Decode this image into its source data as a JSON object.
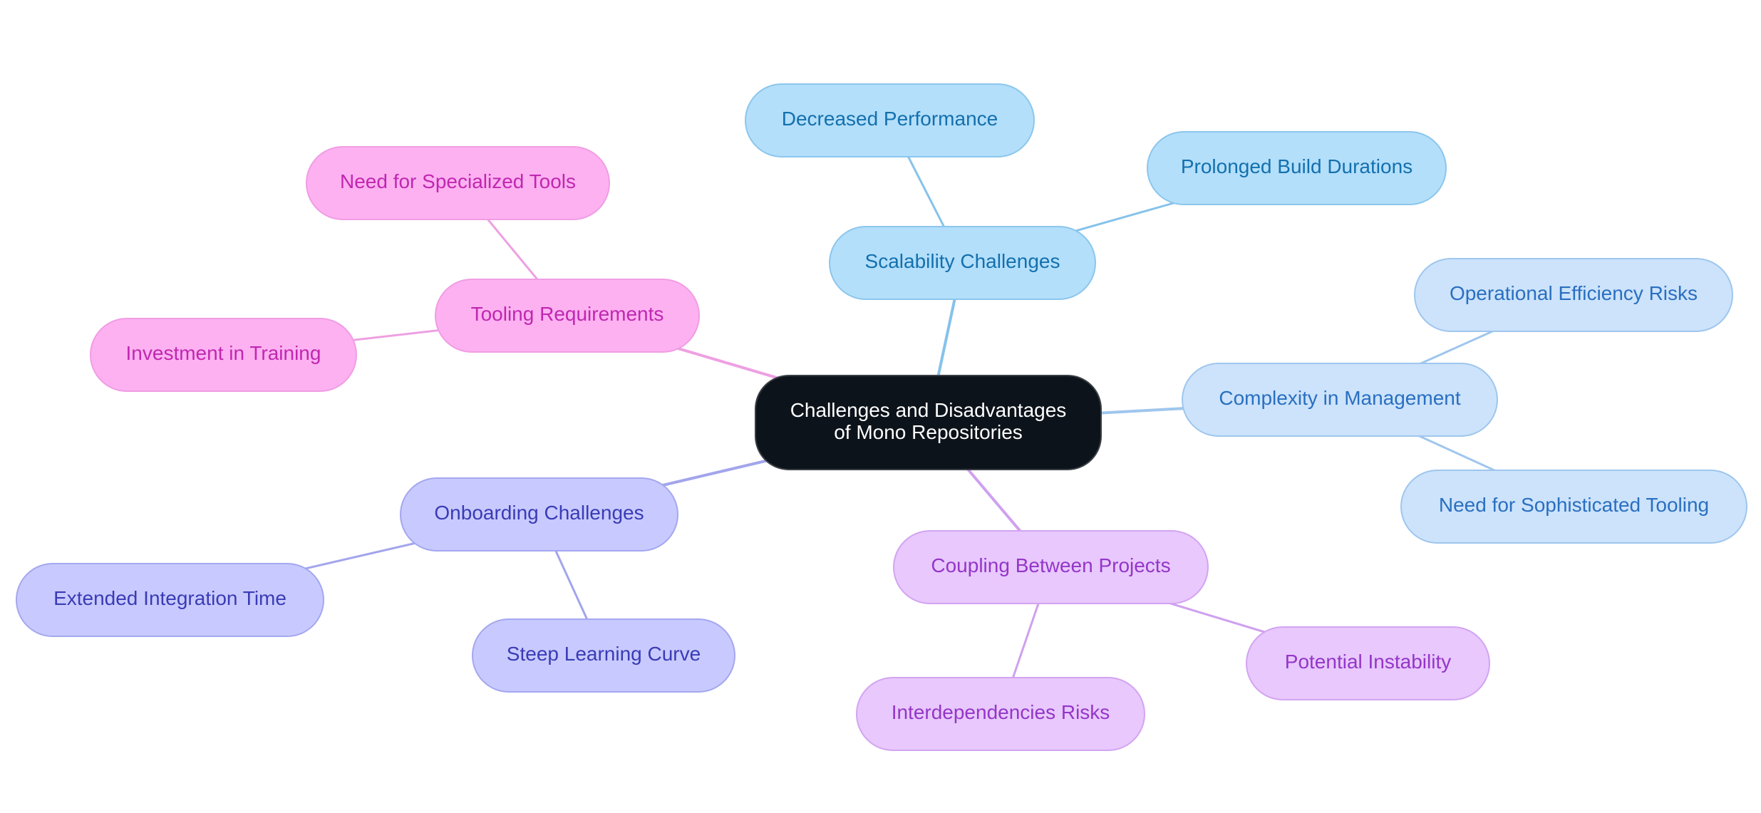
{
  "title": "Challenges and Disadvantages of Mono Repositories",
  "palette": {
    "root": {
      "fill": "#0d131a",
      "stroke": "#3a3f45",
      "text": "#ffffff",
      "edge": "#0d131a"
    },
    "sky": {
      "fill": "#b3dffb",
      "stroke": "#8cc6ec",
      "text": "#1470ad",
      "edge": "#86c2ea"
    },
    "blue": {
      "fill": "#cce3fb",
      "stroke": "#9fc6ee",
      "text": "#2a6fc0",
      "edge": "#9fc6ee"
    },
    "pink": {
      "fill": "#fdb1f1",
      "stroke": "#f09de4",
      "text": "#c027b0",
      "edge": "#eea0e2"
    },
    "indigo": {
      "fill": "#c8caff",
      "stroke": "#a4a7ef",
      "text": "#3a3bb5",
      "edge": "#a2a5ec"
    },
    "purple": {
      "fill": "#e8c8fd",
      "stroke": "#d3a4f1",
      "text": "#9436c8",
      "edge": "#cfa0ef"
    }
  },
  "nodes": [
    {
      "id": "root",
      "label_lines": [
        "Challenges and Disadvantages",
        "of Mono Repositories"
      ],
      "label": "Challenges and Disadvantages of Mono Repositories",
      "theme": "root",
      "parent": null
    },
    {
      "id": "scalability",
      "label": "Scalability Challenges",
      "theme": "sky",
      "parent": "root"
    },
    {
      "id": "decreased-performance",
      "label": "Decreased Performance",
      "theme": "sky",
      "parent": "scalability"
    },
    {
      "id": "prolonged-build",
      "label": "Prolonged Build Durations",
      "theme": "sky",
      "parent": "scalability"
    },
    {
      "id": "complexity",
      "label": "Complexity in Management",
      "theme": "blue",
      "parent": "root"
    },
    {
      "id": "operational-efficiency",
      "label": "Operational Efficiency Risks",
      "theme": "blue",
      "parent": "complexity"
    },
    {
      "id": "sophisticated-tooling",
      "label": "Need for Sophisticated Tooling",
      "theme": "blue",
      "parent": "complexity"
    },
    {
      "id": "coupling",
      "label": "Coupling Between Projects",
      "theme": "purple",
      "parent": "root"
    },
    {
      "id": "potential-instability",
      "label": "Potential Instability",
      "theme": "purple",
      "parent": "coupling"
    },
    {
      "id": "interdependencies",
      "label": "Interdependencies Risks",
      "theme": "purple",
      "parent": "coupling"
    },
    {
      "id": "onboarding",
      "label": "Onboarding Challenges",
      "theme": "indigo",
      "parent": "root"
    },
    {
      "id": "extended-integration",
      "label": "Extended Integration Time",
      "theme": "indigo",
      "parent": "onboarding"
    },
    {
      "id": "steep-learning",
      "label": "Steep Learning Curve",
      "theme": "indigo",
      "parent": "onboarding"
    },
    {
      "id": "tooling",
      "label": "Tooling Requirements",
      "theme": "pink",
      "parent": "root"
    },
    {
      "id": "specialized-tools",
      "label": "Need for Specialized Tools",
      "theme": "pink",
      "parent": "tooling"
    },
    {
      "id": "investment-training",
      "label": "Investment in Training",
      "theme": "pink",
      "parent": "tooling"
    }
  ]
}
